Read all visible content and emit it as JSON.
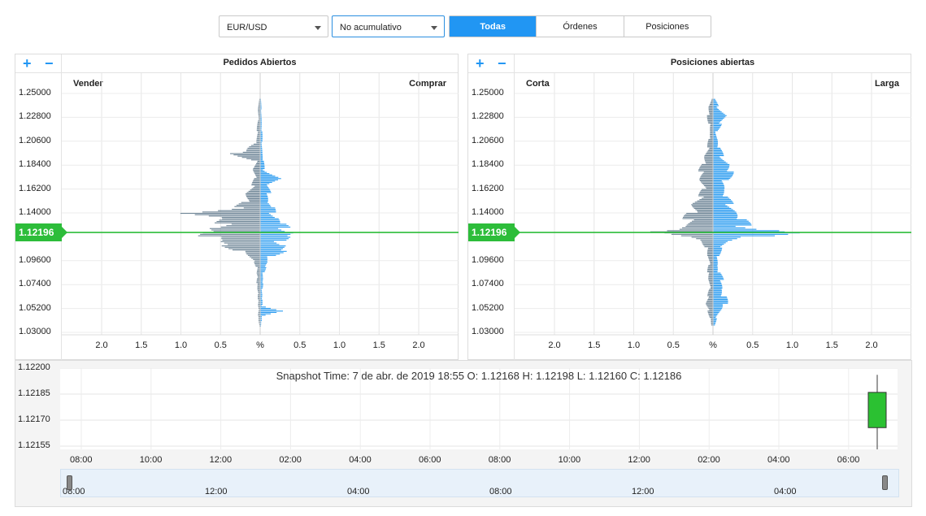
{
  "controls": {
    "symbol": "EUR/USD",
    "mode": "No acumulativo",
    "tabs": [
      "Todas",
      "Órdenes",
      "Posiciones"
    ]
  },
  "colors": {
    "accent": "#2196f3",
    "price_line": "#2dbd3a",
    "left_bars": "#6e8596",
    "right_bars": "#2c9cf0"
  },
  "icons": {
    "zoom_in": "+",
    "zoom_out": "−"
  },
  "left_panel": {
    "title": "Pedidos Abiertos",
    "left_label": "Vender",
    "right_label": "Comprar"
  },
  "right_panel": {
    "title": "Posiciones abiertas",
    "left_label": "Corta",
    "right_label": "Larga"
  },
  "price_ticks": [
    "1.25000",
    "1.22800",
    "1.20600",
    "1.18400",
    "1.16200",
    "1.14000",
    "1.09600",
    "1.07400",
    "1.05200",
    "1.03000"
  ],
  "current_price": "1.12196",
  "x_ticks": [
    "2.0",
    "1.5",
    "1.0",
    "0.5",
    "%",
    "0.5",
    "1.0",
    "1.5",
    "2.0"
  ],
  "chart_data": [
    {
      "type": "bar",
      "title": "Pedidos Abiertos",
      "orientation": "horizontal",
      "ylim": [
        1.03,
        1.25
      ],
      "xlim": [
        -2.5,
        2.5
      ],
      "series": [
        {
          "name": "Vender",
          "profile": [
            [
              1.245,
              0.02
            ],
            [
              1.235,
              0.03
            ],
            [
              1.225,
              0.03
            ],
            [
              1.215,
              0.05
            ],
            [
              1.205,
              0.05
            ],
            [
              1.195,
              0.4
            ],
            [
              1.188,
              0.06
            ],
            [
              1.18,
              0.1
            ],
            [
              1.172,
              0.08
            ],
            [
              1.165,
              0.12
            ],
            [
              1.158,
              0.2
            ],
            [
              1.15,
              0.25
            ],
            [
              1.145,
              0.35
            ],
            [
              1.14,
              1.1
            ],
            [
              1.135,
              0.5
            ],
            [
              1.13,
              0.6
            ],
            [
              1.126,
              0.7
            ],
            [
              1.122,
              0.75
            ],
            [
              1.118,
              0.8
            ],
            [
              1.114,
              0.55
            ],
            [
              1.11,
              0.5
            ],
            [
              1.105,
              0.3
            ],
            [
              1.1,
              0.15
            ],
            [
              1.095,
              0.08
            ],
            [
              1.09,
              0.05
            ],
            [
              1.085,
              0.05
            ],
            [
              1.08,
              0.04
            ],
            [
              1.075,
              0.05
            ],
            [
              1.07,
              0.04
            ],
            [
              1.065,
              0.03
            ],
            [
              1.06,
              0.03
            ],
            [
              1.055,
              0.03
            ],
            [
              1.05,
              0.02
            ],
            [
              1.045,
              0.03
            ],
            [
              1.04,
              0.02
            ],
            [
              1.035,
              0.01
            ]
          ]
        },
        {
          "name": "Comprar",
          "profile": [
            [
              1.245,
              0.01
            ],
            [
              1.235,
              0.02
            ],
            [
              1.225,
              0.02
            ],
            [
              1.215,
              0.03
            ],
            [
              1.205,
              0.03
            ],
            [
              1.195,
              0.03
            ],
            [
              1.188,
              0.05
            ],
            [
              1.18,
              0.06
            ],
            [
              1.172,
              0.28
            ],
            [
              1.165,
              0.1
            ],
            [
              1.158,
              0.15
            ],
            [
              1.15,
              0.1
            ],
            [
              1.145,
              0.2
            ],
            [
              1.14,
              0.2
            ],
            [
              1.135,
              0.25
            ],
            [
              1.13,
              0.35
            ],
            [
              1.126,
              0.4
            ],
            [
              1.122,
              0.45
            ],
            [
              1.118,
              0.4
            ],
            [
              1.114,
              0.3
            ],
            [
              1.11,
              0.35
            ],
            [
              1.105,
              0.35
            ],
            [
              1.1,
              0.15
            ],
            [
              1.095,
              0.1
            ],
            [
              1.09,
              0.08
            ],
            [
              1.085,
              0.05
            ],
            [
              1.08,
              0.04
            ],
            [
              1.075,
              0.04
            ],
            [
              1.07,
              0.03
            ],
            [
              1.065,
              0.03
            ],
            [
              1.06,
              0.03
            ],
            [
              1.055,
              0.03
            ],
            [
              1.05,
              0.32
            ],
            [
              1.045,
              0.02
            ],
            [
              1.04,
              0.02
            ],
            [
              1.035,
              0.01
            ]
          ]
        }
      ]
    },
    {
      "type": "bar",
      "title": "Posiciones abiertas",
      "orientation": "horizontal",
      "ylim": [
        1.03,
        1.25
      ],
      "xlim": [
        -2.5,
        2.5
      ],
      "series": [
        {
          "name": "Corta",
          "profile": [
            [
              1.245,
              0.03
            ],
            [
              1.238,
              0.06
            ],
            [
              1.23,
              0.08
            ],
            [
              1.222,
              0.06
            ],
            [
              1.215,
              0.04
            ],
            [
              1.208,
              0.06
            ],
            [
              1.2,
              0.08
            ],
            [
              1.192,
              0.12
            ],
            [
              1.185,
              0.15
            ],
            [
              1.178,
              0.2
            ],
            [
              1.17,
              0.18
            ],
            [
              1.162,
              0.15
            ],
            [
              1.155,
              0.2
            ],
            [
              1.148,
              0.3
            ],
            [
              1.14,
              0.35
            ],
            [
              1.134,
              0.4
            ],
            [
              1.128,
              0.38
            ],
            [
              1.124,
              0.6
            ],
            [
              1.122,
              1.0
            ],
            [
              1.118,
              0.3
            ],
            [
              1.114,
              0.15
            ],
            [
              1.108,
              0.1
            ],
            [
              1.1,
              0.07
            ],
            [
              1.092,
              0.06
            ],
            [
              1.085,
              0.08
            ],
            [
              1.078,
              0.06
            ],
            [
              1.07,
              0.05
            ],
            [
              1.063,
              0.08
            ],
            [
              1.056,
              0.1
            ],
            [
              1.05,
              0.07
            ],
            [
              1.043,
              0.04
            ],
            [
              1.036,
              0.02
            ]
          ]
        },
        {
          "name": "Larga",
          "profile": [
            [
              1.245,
              0.03
            ],
            [
              1.238,
              0.08
            ],
            [
              1.23,
              0.18
            ],
            [
              1.222,
              0.12
            ],
            [
              1.215,
              0.05
            ],
            [
              1.208,
              0.06
            ],
            [
              1.2,
              0.1
            ],
            [
              1.192,
              0.15
            ],
            [
              1.185,
              0.22
            ],
            [
              1.178,
              0.28
            ],
            [
              1.17,
              0.2
            ],
            [
              1.162,
              0.15
            ],
            [
              1.155,
              0.2
            ],
            [
              1.148,
              0.28
            ],
            [
              1.14,
              0.32
            ],
            [
              1.134,
              0.45
            ],
            [
              1.128,
              0.5
            ],
            [
              1.124,
              0.9
            ],
            [
              1.122,
              1.15
            ],
            [
              1.118,
              0.6
            ],
            [
              1.114,
              0.2
            ],
            [
              1.108,
              0.12
            ],
            [
              1.1,
              0.08
            ],
            [
              1.092,
              0.06
            ],
            [
              1.085,
              0.1
            ],
            [
              1.078,
              0.15
            ],
            [
              1.07,
              0.12
            ],
            [
              1.063,
              0.18
            ],
            [
              1.056,
              0.2
            ],
            [
              1.05,
              0.1
            ],
            [
              1.043,
              0.05
            ],
            [
              1.036,
              0.02
            ]
          ]
        }
      ]
    },
    {
      "type": "candlestick",
      "ylim": [
        1.12155,
        1.122
      ],
      "y_ticks": [
        "1.12200",
        "1.12185",
        "1.12170",
        "1.12155"
      ],
      "x_ticks": [
        "08:00",
        "10:00",
        "12:00",
        "02:00",
        "04:00",
        "06:00",
        "08:00",
        "10:00",
        "12:00",
        "02:00",
        "04:00",
        "06:00"
      ],
      "candle": {
        "open": 1.12168,
        "high": 1.12198,
        "low": 1.1216,
        "close": 1.12186
      },
      "snapshot": "Snapshot Time: 7 de abr. de 2019 18:55   O: 1.12168   H: 1.12198   L: 1.12160   C: 1.12186"
    }
  ],
  "navigator": {
    "ticks": [
      "08:00",
      "12:00",
      "04:00",
      "08:00",
      "12:00",
      "04:00"
    ]
  }
}
